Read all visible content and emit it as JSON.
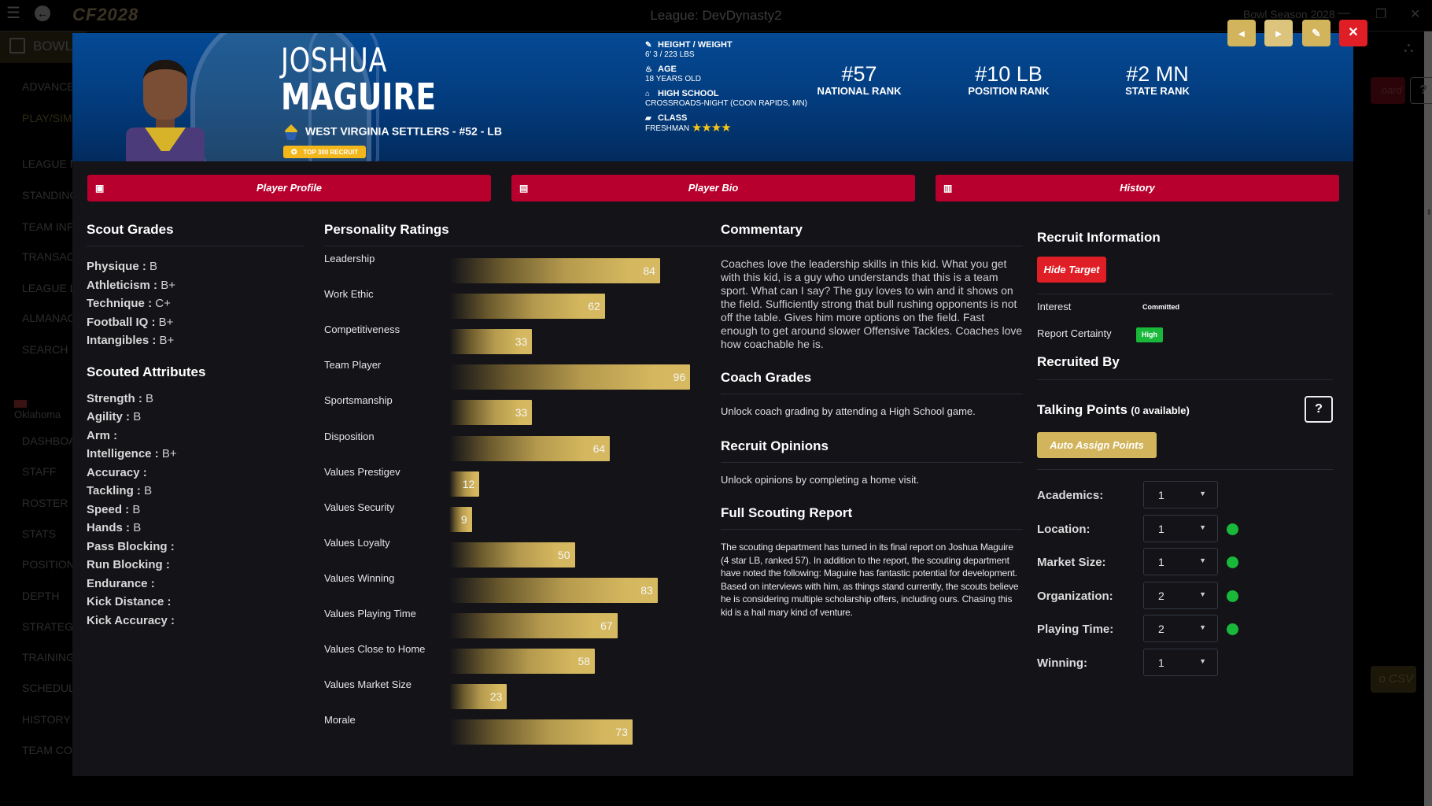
{
  "app": {
    "logo": "CF2028",
    "league_title": "League: DevDynasty2",
    "season": "Bowl Season 2028",
    "window_controls": [
      "minimize",
      "restore",
      "close"
    ]
  },
  "sidebar": {
    "current": "BOWL",
    "items": [
      {
        "label": "ADVANCE",
        "accent": false
      },
      {
        "label": "PLAY/SIM",
        "accent": true
      },
      {
        "label": "LEAGUE MENU",
        "accent": false
      },
      {
        "label": "STANDINGS",
        "accent": false
      },
      {
        "label": "TEAM INFO",
        "accent": false
      },
      {
        "label": "TRANSACTIONS",
        "accent": false
      },
      {
        "label": "LEAGUE LEADERS",
        "accent": false
      },
      {
        "label": "ALMANAC",
        "accent": false
      },
      {
        "label": "SEARCH",
        "accent": false
      }
    ],
    "team": "Oklahoma",
    "team_items": [
      "DASHBOARD",
      "STAFF",
      "ROSTER",
      "STATS",
      "POSITIONS",
      "DEPTH",
      "STRATEGY",
      "TRAINING",
      "SCHEDULE",
      "HISTORY",
      "TEAM CONTROL"
    ]
  },
  "background_right": {
    "board_label": "oard",
    "help_label": "?",
    "csv_label": "o CSV"
  },
  "player": {
    "first_name": "JOSHUA",
    "last_name": "MAGUIRE",
    "team_line": "WEST VIRGINIA SETTLERS - #52 - LB",
    "badge": "TOP 300 RECRUIT",
    "bio": [
      {
        "icon": "ruler-icon",
        "glyph": "✎",
        "label": "HEIGHT / WEIGHT",
        "value": "6' 3 / 223 LBS"
      },
      {
        "icon": "cake-icon",
        "glyph": "♨",
        "label": "AGE",
        "value": "18 YEARS OLD"
      },
      {
        "icon": "school-icon",
        "glyph": "⌂",
        "label": "HIGH SCHOOL",
        "value": "CROSSROADS-NIGHT (COON RAPIDS, MN)"
      },
      {
        "icon": "graduation-cap-icon",
        "glyph": "▰",
        "label": "CLASS",
        "value": "FRESHMAN"
      }
    ],
    "stars": 4,
    "stars_text": "★★★★",
    "ranks": [
      {
        "value": "#57",
        "label": "NATIONAL RANK"
      },
      {
        "value": "#10 LB",
        "label": "POSITION RANK"
      },
      {
        "value": "#2 MN",
        "label": "STATE RANK"
      }
    ]
  },
  "controls": {
    "prev": "◂",
    "next": "▸",
    "edit": "✎",
    "close": "✕"
  },
  "tabs": [
    {
      "label": "Player Profile",
      "icon": "reader-icon"
    },
    {
      "label": "Player Bio",
      "icon": "id-card-icon"
    },
    {
      "label": "History",
      "icon": "archive-icon"
    }
  ],
  "scout_grades": {
    "title": "Scout Grades",
    "items": [
      {
        "label": "Physique",
        "value": "B"
      },
      {
        "label": "Athleticism",
        "value": "B+"
      },
      {
        "label": "Technique",
        "value": "C+"
      },
      {
        "label": "Football IQ",
        "value": "B+"
      },
      {
        "label": "Intangibles",
        "value": "B+"
      }
    ]
  },
  "scouted_attributes": {
    "title": "Scouted Attributes",
    "items": [
      {
        "label": "Strength",
        "value": "B"
      },
      {
        "label": "Agility",
        "value": "B"
      },
      {
        "label": "Arm",
        "value": ""
      },
      {
        "label": "Intelligence",
        "value": "B+"
      },
      {
        "label": "Accuracy",
        "value": ""
      },
      {
        "label": "Tackling",
        "value": "B"
      },
      {
        "label": "Speed",
        "value": "B"
      },
      {
        "label": "Hands",
        "value": "B"
      },
      {
        "label": "Pass Blocking",
        "value": ""
      },
      {
        "label": "Run Blocking",
        "value": ""
      },
      {
        "label": "Endurance",
        "value": ""
      },
      {
        "label": "Kick Distance",
        "value": ""
      },
      {
        "label": "Kick Accuracy",
        "value": ""
      }
    ]
  },
  "personality": {
    "title": "Personality Ratings",
    "max": 100,
    "items": [
      {
        "label": "Leadership",
        "value": 84
      },
      {
        "label": "Work Ethic",
        "value": 62
      },
      {
        "label": "Competitiveness",
        "value": 33
      },
      {
        "label": "Team Player",
        "value": 96
      },
      {
        "label": "Sportsmanship",
        "value": 33
      },
      {
        "label": "Disposition",
        "value": 64
      },
      {
        "label": "Values Prestigev",
        "value": 12
      },
      {
        "label": "Values Security",
        "value": 9
      },
      {
        "label": "Values Loyalty",
        "value": 50
      },
      {
        "label": "Values Winning",
        "value": 83
      },
      {
        "label": "Values Playing Time",
        "value": 67
      },
      {
        "label": "Values Close to Home",
        "value": 58
      },
      {
        "label": "Values Market Size",
        "value": 23
      },
      {
        "label": "Morale",
        "value": 73
      }
    ]
  },
  "commentary": {
    "title": "Commentary",
    "text": "Coaches love the leadership skills in this kid. What you get with this kid, is a guy who understands that this is a team sport. What can I say? The guy loves to win and it shows on the field. Sufficiently strong that bull rushing opponents is not off the table. Gives him more options on the field. Fast enough to get around slower Offensive Tackles. Coaches love how coachable he is."
  },
  "coach_grades": {
    "title": "Coach Grades",
    "text": "Unlock coach grading by attending a High School game."
  },
  "recruit_opinions": {
    "title": "Recruit Opinions",
    "text": "Unlock opinions by completing a home visit."
  },
  "scouting_report": {
    "title": "Full Scouting Report",
    "text": "The scouting department has turned in its final report on Joshua Maguire (4 star LB, ranked 57). In addition to the report, the scouting department have noted the following: Maguire has fantastic potential for development. Based on interviews with him, as things stand currently, the scouts believe he is considering multiple scholarship offers, including ours. Chasing this kid is a hail mary kind of venture."
  },
  "recruit_info": {
    "title": "Recruit Information",
    "hide_target_label": "Hide Target",
    "interest_label": "Interest",
    "interest_value": "Committed",
    "certainty_label": "Report Certainty",
    "certainty_value": "High",
    "recruited_by_title": "Recruited By",
    "talking_points_title": "Talking Points",
    "talking_points_available": "(0 available)",
    "help_label": "?",
    "auto_assign_label": "Auto Assign Points",
    "points": [
      {
        "label": "Academics:",
        "value": "1",
        "indicator": false
      },
      {
        "label": "Location:",
        "value": "1",
        "indicator": true
      },
      {
        "label": "Market Size:",
        "value": "1",
        "indicator": true
      },
      {
        "label": "Organization:",
        "value": "2",
        "indicator": true
      },
      {
        "label": "Playing Time:",
        "value": "2",
        "indicator": true
      },
      {
        "label": "Winning:",
        "value": "1",
        "indicator": false
      }
    ]
  },
  "colors": {
    "banner_blue": "#044a95",
    "tab_red": "#b8002e",
    "close_red": "#e01e26",
    "gold": "#d2b45c",
    "success_green": "#19b83a",
    "panel_bg": "#131318"
  }
}
